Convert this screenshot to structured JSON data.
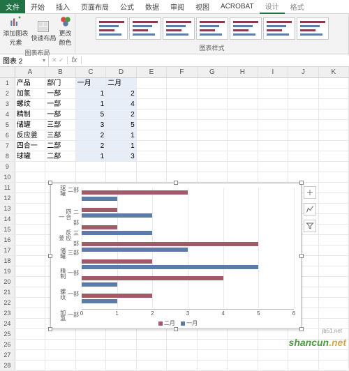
{
  "tabs": {
    "file": "文件",
    "home": "开始",
    "insert": "插入",
    "page": "页面布局",
    "formula": "公式",
    "data": "数据",
    "review": "审阅",
    "view": "视图",
    "acrobat": "ACROBAT",
    "design": "设计",
    "format": "格式"
  },
  "ribbon": {
    "layout_group": "图表布局",
    "styles_group": "图表样式",
    "add_element": "添加图表\n元素",
    "quick_layout": "快速布局",
    "change_colors": "更改\n颜色"
  },
  "namebox": "图表 2",
  "fx": "fx",
  "columns": [
    "A",
    "B",
    "C",
    "D",
    "E",
    "F",
    "G",
    "H",
    "I",
    "J",
    "K"
  ],
  "table": {
    "header": [
      "产品",
      "部门",
      "一月",
      "二月"
    ],
    "rows": [
      [
        "加氢",
        "一部",
        "1",
        "2"
      ],
      [
        "螺纹",
        "一部",
        "1",
        "4"
      ],
      [
        "精制",
        "一部",
        "5",
        "2"
      ],
      [
        "储罐",
        "三部",
        "3",
        "5"
      ],
      [
        "反应釜",
        "三部",
        "2",
        "1"
      ],
      [
        "四合一",
        "二部",
        "2",
        "1"
      ],
      [
        "球罐",
        "二部",
        "1",
        "3"
      ]
    ]
  },
  "chart_data": {
    "type": "bar",
    "orientation": "horizontal",
    "categories": [
      {
        "product": "球罐",
        "dept": "二部"
      },
      {
        "product": "四合一",
        "dept": "二部"
      },
      {
        "product": "反应釜",
        "dept": "三部"
      },
      {
        "product": "储罐",
        "dept": "三部"
      },
      {
        "product": "精制",
        "dept": "一部"
      },
      {
        "product": "螺纹",
        "dept": "一部"
      },
      {
        "product": "加氢",
        "dept": "一部"
      }
    ],
    "series": [
      {
        "name": "二月",
        "values": [
          3,
          1,
          1,
          5,
          2,
          4,
          2
        ],
        "color": "#a25a68"
      },
      {
        "name": "一月",
        "values": [
          1,
          2,
          2,
          3,
          5,
          1,
          1
        ],
        "color": "#5b7ba8"
      }
    ],
    "xlim": [
      0,
      6
    ],
    "xticks": [
      0,
      1,
      2,
      3,
      4,
      5,
      6
    ],
    "legend": [
      "二月",
      "一月"
    ]
  },
  "watermark": {
    "brand": "shancun",
    "tld": ".net",
    "alt": "jb51.net"
  }
}
